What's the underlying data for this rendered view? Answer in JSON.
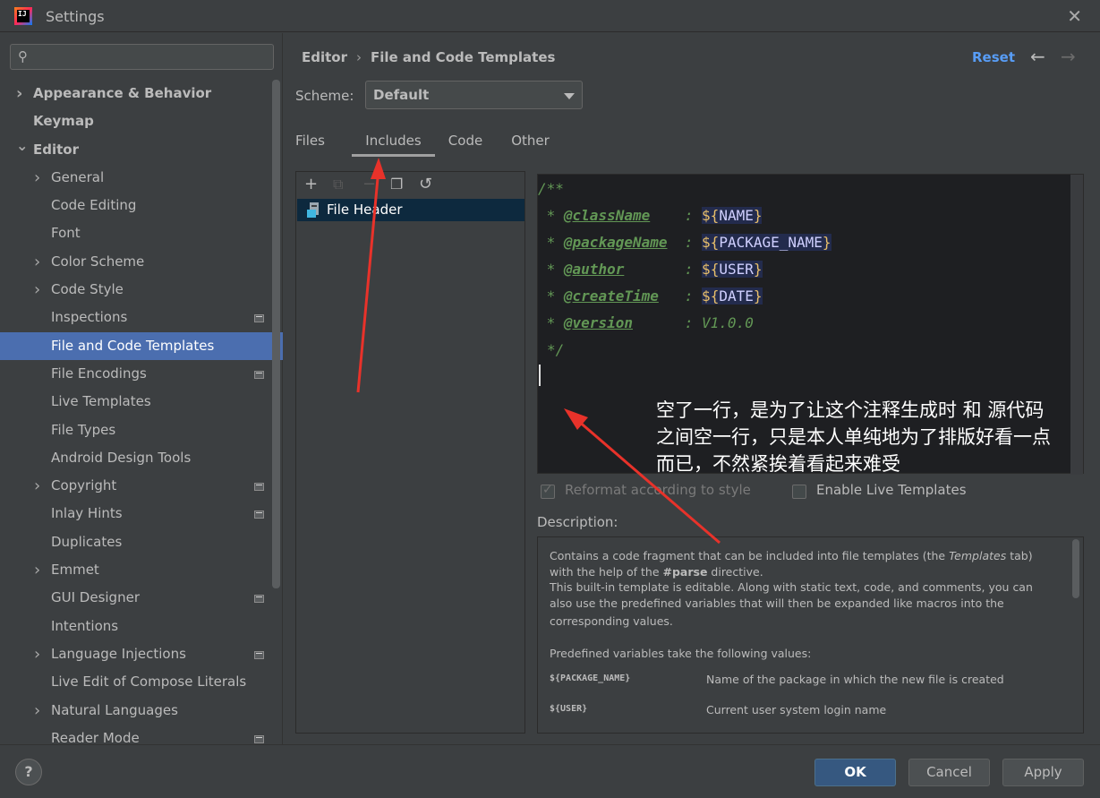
{
  "window": {
    "title": "Settings",
    "logo_text": "IJ"
  },
  "sidebar": {
    "search_placeholder": "",
    "items": [
      {
        "label": "Appearance & Behavior",
        "level": 0,
        "chevron": "right",
        "bold": true
      },
      {
        "label": "Keymap",
        "level": 0,
        "chevron": "",
        "bold": true
      },
      {
        "label": "Editor",
        "level": 0,
        "chevron": "down",
        "bold": true
      },
      {
        "label": "General",
        "level": 1,
        "chevron": "right"
      },
      {
        "label": "Code Editing",
        "level": 1,
        "chevron": ""
      },
      {
        "label": "Font",
        "level": 1,
        "chevron": ""
      },
      {
        "label": "Color Scheme",
        "level": 1,
        "chevron": "right"
      },
      {
        "label": "Code Style",
        "level": 1,
        "chevron": "right"
      },
      {
        "label": "Inspections",
        "level": 1,
        "chevron": "",
        "project_icon": true
      },
      {
        "label": "File and Code Templates",
        "level": 1,
        "chevron": "",
        "selected": true
      },
      {
        "label": "File Encodings",
        "level": 1,
        "chevron": "",
        "project_icon": true
      },
      {
        "label": "Live Templates",
        "level": 1,
        "chevron": ""
      },
      {
        "label": "File Types",
        "level": 1,
        "chevron": ""
      },
      {
        "label": "Android Design Tools",
        "level": 1,
        "chevron": ""
      },
      {
        "label": "Copyright",
        "level": 1,
        "chevron": "right",
        "project_icon": true
      },
      {
        "label": "Inlay Hints",
        "level": 1,
        "chevron": "",
        "project_icon": true
      },
      {
        "label": "Duplicates",
        "level": 1,
        "chevron": ""
      },
      {
        "label": "Emmet",
        "level": 1,
        "chevron": "right"
      },
      {
        "label": "GUI Designer",
        "level": 1,
        "chevron": "",
        "project_icon": true
      },
      {
        "label": "Intentions",
        "level": 1,
        "chevron": ""
      },
      {
        "label": "Language Injections",
        "level": 1,
        "chevron": "right",
        "project_icon": true
      },
      {
        "label": "Live Edit of Compose Literals",
        "level": 1,
        "chevron": ""
      },
      {
        "label": "Natural Languages",
        "level": 1,
        "chevron": "right"
      },
      {
        "label": "Reader Mode",
        "level": 1,
        "chevron": "",
        "project_icon": true
      }
    ]
  },
  "header": {
    "breadcrumb_root": "Editor",
    "breadcrumb_sep": "›",
    "breadcrumb_page": "File and Code Templates",
    "reset_label": "Reset",
    "back_icon": "←",
    "forward_icon": "→"
  },
  "scheme": {
    "label": "Scheme:",
    "value": "Default"
  },
  "tabs": [
    {
      "label": "Files",
      "active": false
    },
    {
      "label": "Includes",
      "active": true
    },
    {
      "label": "Code",
      "active": false
    },
    {
      "label": "Other",
      "active": false
    }
  ],
  "list": {
    "toolbar": {
      "add": "+",
      "copy": "⧉",
      "remove": "−",
      "duplicate": "❐",
      "revert": "↺"
    },
    "items": [
      {
        "label": "File Header",
        "selected": true
      }
    ]
  },
  "editor": {
    "open": "/**",
    "lines": [
      {
        "tag": "@className",
        "pad": "    ",
        "var": "NAME"
      },
      {
        "tag": "@packageName",
        "pad": "  ",
        "var": "PACKAGE_NAME"
      },
      {
        "tag": "@author",
        "pad": "       ",
        "var": "USER"
      },
      {
        "tag": "@createTime",
        "pad": "   ",
        "var": "DATE"
      }
    ],
    "version_tag": "@version",
    "version_pad": "      ",
    "version_value": "V1.0.0",
    "close": "*/",
    "annotation": [
      "空了一行，是为了让这个注释生成时 和 源代码",
      "之间空一行，只是本人单纯地为了排版好看一点",
      "而已，不然紧挨着看起来难受"
    ]
  },
  "options": {
    "reformat_label": "Reformat according to style",
    "reformat_checked": true,
    "live_templates_label": "Enable Live Templates",
    "live_templates_checked": false
  },
  "description": {
    "label": "Description:",
    "p1_before": "Contains a code fragment that can be included into file templates (the ",
    "p1_italic": "Templates",
    "p1_after": " tab)",
    "p2_before": "with the help of the ",
    "p2_bold": "#parse",
    "p2_after": " directive.",
    "p3": "This built-in template is editable. Along with static text, code, and comments, you can",
    "p4": "also use the predefined variables that will then be expanded like macros into the",
    "p5": "corresponding values.",
    "p6": "Predefined variables take the following values:",
    "vars": [
      {
        "name": "${PACKAGE_NAME}",
        "text": "Name of the package in which the new file is created"
      },
      {
        "name": "${USER}",
        "text": "Current user system login name"
      }
    ]
  },
  "footer": {
    "help": "?",
    "ok": "OK",
    "cancel": "Cancel",
    "apply": "Apply"
  }
}
